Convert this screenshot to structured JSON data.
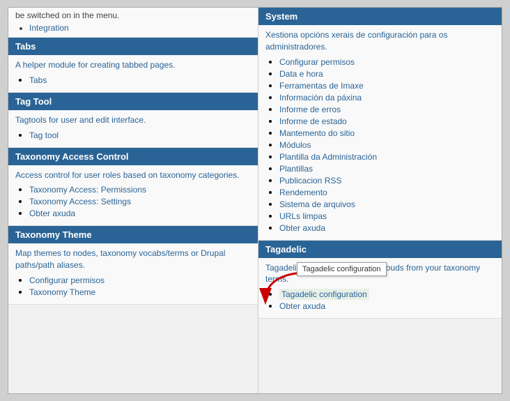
{
  "left": {
    "partial_text": "be switched on in the menu.",
    "partial_link": "Integration",
    "sections": [
      {
        "id": "tabs",
        "header": "Tabs",
        "desc": "A helper module for creating tabbed pages.",
        "items": [
          "Tabs"
        ]
      },
      {
        "id": "tag-tool",
        "header": "Tag Tool",
        "desc": "Tagtools for user and edit interface.",
        "items": [
          "Tag tool"
        ]
      },
      {
        "id": "taxonomy-access-control",
        "header": "Taxonomy Access Control",
        "desc": "Access control for user roles based on taxonomy categories.",
        "items": [
          "Taxonomy Access: Permissions",
          "Taxonomy Access: Settings",
          "Obter axuda"
        ]
      },
      {
        "id": "taxonomy-theme",
        "header": "Taxonomy Theme",
        "desc": "Map themes to nodes, taxonomy vocabs/terms or Drupal paths/path aliases.",
        "items": [
          "Configurar permisos",
          "Taxonomy Theme"
        ]
      }
    ]
  },
  "right": {
    "sections": [
      {
        "id": "system",
        "header": "System",
        "desc": "Xestiona opcións xerais de configuración para os administradores.",
        "items": [
          "Configurar permisos",
          "Data e hora",
          "Ferramentas de Imaxe",
          "Información da páxina",
          "Informe de erros",
          "Informe de estado",
          "Mantemento do sitio",
          "Módulos",
          "Plantilla da Administración",
          "Plantillas",
          "Publicacion RSS",
          "Rendemento",
          "Sistema de arquivos",
          "URLs limpas",
          "Obter axuda"
        ]
      },
      {
        "id": "tagadelic",
        "header": "Tagadelic",
        "desc": "Tagadelic makes weighted tag clouds from your taxonomy terms.",
        "items": [
          "Tagadelic configuration",
          "Obter axuda"
        ]
      }
    ],
    "tooltip": "Tagadelic configuration"
  }
}
